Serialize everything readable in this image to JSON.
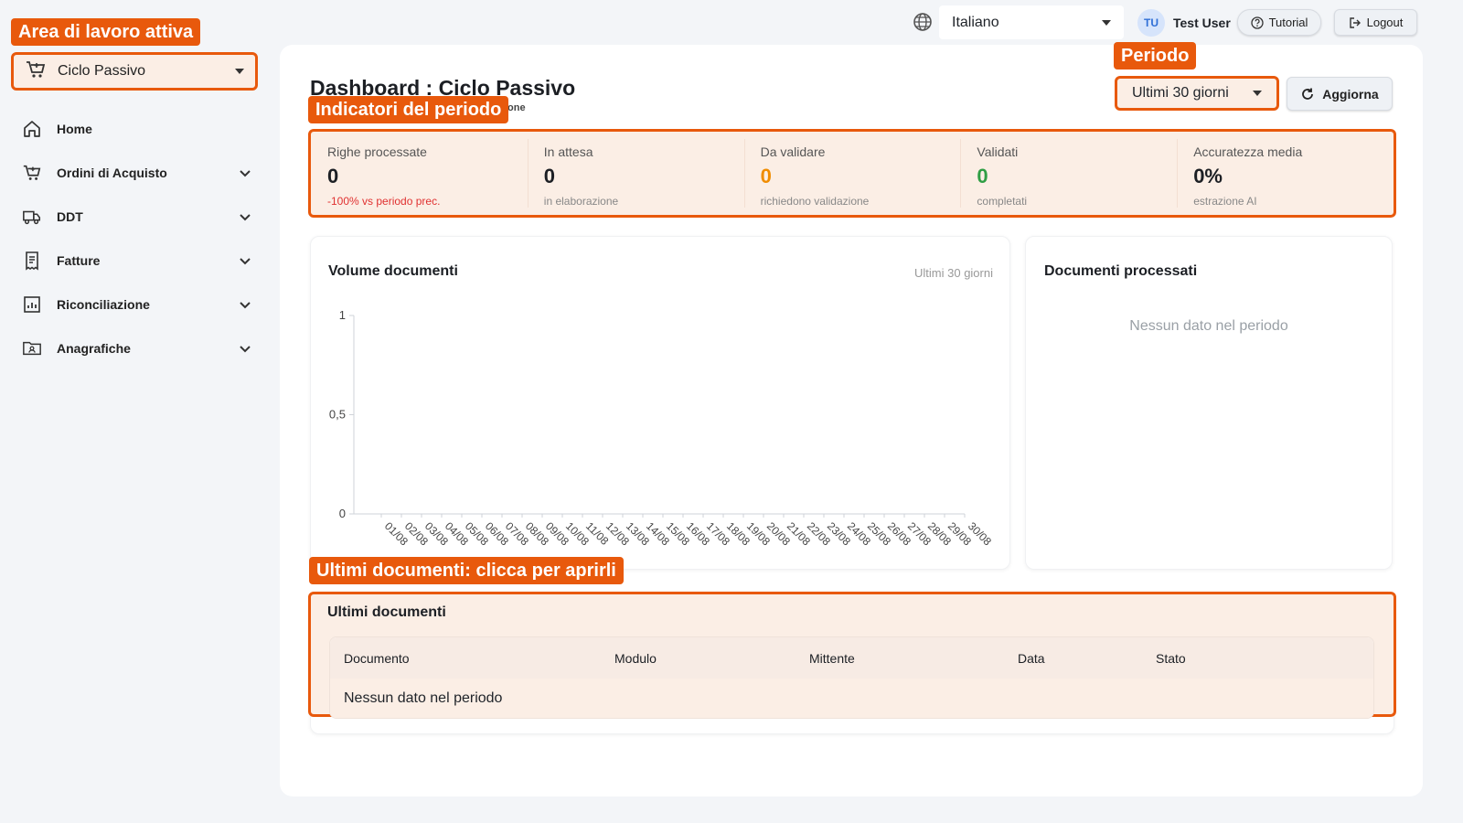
{
  "sidebar": {
    "workspace_callout": "Area di lavoro attiva",
    "workspace_label": "Ciclo Passivo",
    "items": [
      {
        "label": "Home",
        "icon": "home-icon"
      },
      {
        "label": "Ordini di Acquisto",
        "icon": "cart-icon"
      },
      {
        "label": "DDT",
        "icon": "truck-icon"
      },
      {
        "label": "Fatture",
        "icon": "invoice-icon"
      },
      {
        "label": "Riconciliazione",
        "icon": "chart-icon"
      },
      {
        "label": "Anagrafiche",
        "icon": "contacts-folder-icon"
      }
    ]
  },
  "topbar": {
    "language": "Italiano",
    "avatar_initials": "TU",
    "user_name": "Test User",
    "tutorial_label": "Tutorial",
    "logout_label": "Logout"
  },
  "header": {
    "title": "Dashboard : Ciclo Passivo",
    "subtitle_fragment": "one",
    "kpi_callout": "Indicatori del periodo",
    "period_callout": "Periodo",
    "period_value": "Ultimi 30 giorni",
    "refresh_label": "Aggiorna"
  },
  "kpis": [
    {
      "label": "Righe processate",
      "value": "0",
      "sub": "-100% vs periodo prec.",
      "color": "#1c1f24",
      "sub_color": "#e03131"
    },
    {
      "label": "In attesa",
      "value": "0",
      "sub": "in elaborazione",
      "color": "#1c1f24",
      "sub_color": "#888888"
    },
    {
      "label": "Da validare",
      "value": "0",
      "sub": "richiedono validazione",
      "color": "#f08c00",
      "sub_color": "#888888"
    },
    {
      "label": "Validati",
      "value": "0",
      "sub": "completati",
      "color": "#2f9e44",
      "sub_color": "#888888"
    },
    {
      "label": "Accuratezza media",
      "value": "0%",
      "sub": "estrazione AI",
      "color": "#1c1f24",
      "sub_color": "#888888"
    }
  ],
  "volume_card": {
    "title": "Volume documenti",
    "range_label": "Ultimi 30 giorni"
  },
  "chart_data": {
    "type": "line",
    "title": "Volume documenti",
    "x": [
      "01/08",
      "02/08",
      "03/08",
      "04/08",
      "05/08",
      "06/08",
      "07/08",
      "08/08",
      "09/08",
      "10/08",
      "11/08",
      "12/08",
      "13/08",
      "14/08",
      "15/08",
      "16/08",
      "17/08",
      "18/08",
      "19/08",
      "20/08",
      "21/08",
      "22/08",
      "23/08",
      "24/08",
      "25/08",
      "26/08",
      "27/08",
      "28/08",
      "29/08",
      "30/08"
    ],
    "y_ticks": [
      "0",
      "0,5",
      "1"
    ],
    "ylim": [
      0,
      1
    ],
    "series": [],
    "grid": false
  },
  "donut_card": {
    "title": "Documenti processati",
    "empty": "Nessun dato nel periodo"
  },
  "table": {
    "callout": "Ultimi documenti: clicca per aprirli",
    "title": "Ultimi documenti",
    "columns": [
      "Documento",
      "Modulo",
      "Mittente",
      "Data",
      "Stato"
    ],
    "empty": "Nessun dato nel periodo"
  },
  "colors": {
    "accent": "#e8590c",
    "highlight_bg": "#fbeee5"
  }
}
